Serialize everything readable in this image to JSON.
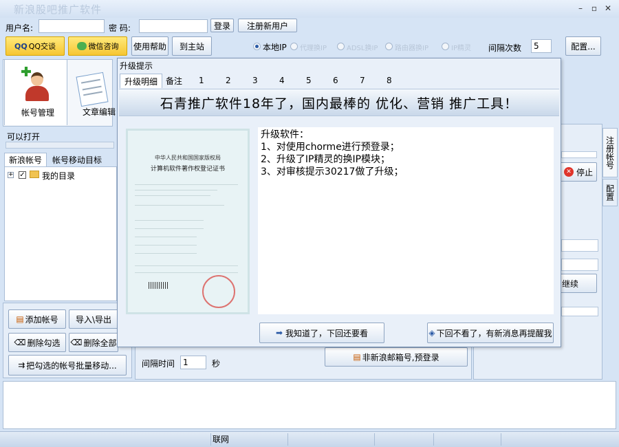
{
  "window": {
    "title": "新浪股吧推广软件",
    "minimize": "–",
    "close": "✕"
  },
  "login": {
    "username_label": "用户名:",
    "password_label": "密  码:",
    "username_value": "",
    "password_value": "",
    "login_button": "登录",
    "register_button": "注册新用户"
  },
  "toolbar": {
    "qq_button": "QQ交谈",
    "wechat_button": "微信咨询",
    "help_button": "使用帮助",
    "home_button": "到主站",
    "ip_options": [
      "本地IP",
      "代理换IP",
      "ADSL换IP",
      "路由器换IP",
      "IP精灵"
    ],
    "interval_label": "间隔次数",
    "interval_value": "5",
    "config_button": "配置..."
  },
  "left": {
    "nav_account": "帐号管理",
    "nav_article": "文章编辑",
    "openable_label": "可以打开",
    "tabs": [
      "新浪帐号",
      "帐号移动目标"
    ],
    "tree_root": "我的目录",
    "expander": "+",
    "add_account": "添加帐号",
    "import_export": "导入\\导出",
    "delete_checked": "删除勾选",
    "delete_all": "删除全部",
    "batch_move": "把勾选的帐号批量移动..."
  },
  "middle": {
    "interval_time_label": "间隔时间",
    "interval_time_value": "1",
    "interval_unit": "秒",
    "prelogin_button": "非新浪邮箱号,预登录"
  },
  "right": {
    "stop_button": "停止",
    "continue_fragment": "继续",
    "side_tabs": [
      "注册帐号",
      "配置"
    ]
  },
  "modal": {
    "title": "升级提示",
    "tabs": [
      "升级明细",
      "备注",
      "1",
      "2",
      "3",
      "4",
      "5",
      "6",
      "7",
      "8"
    ],
    "banner": "石青推广软件18年了，国内最棒的 优化、营销 推广工具！",
    "notes": [
      "升级软件：",
      "1、对使用chorme进行预登录；",
      "2、升级了IP精灵的换IP模块；",
      "3、对审核提示30217做了升级；"
    ],
    "ok_button": "我知道了，下回还要看",
    "dismiss_button": "下回不看了，有新消息再提醒我",
    "certificate": {
      "header": "中华人民共和国国家版权局",
      "title": "计算机软件著作权登记证书"
    }
  },
  "statusbar": {
    "network": "联网"
  },
  "colors": {
    "accent": "#2a5aa6",
    "stop_red": "#e0352b"
  }
}
